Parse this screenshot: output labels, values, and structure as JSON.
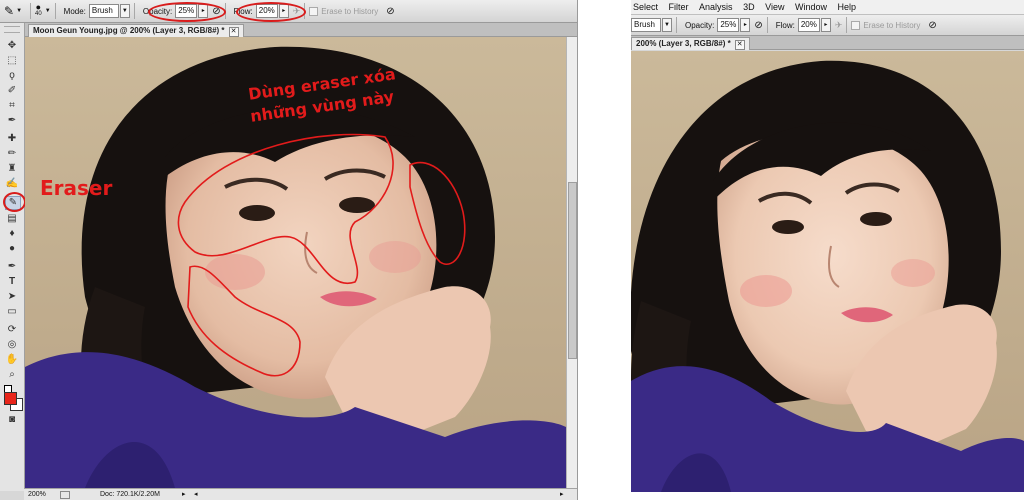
{
  "left": {
    "options": {
      "brush_size": "40",
      "mode_label": "Mode:",
      "mode_value": "Brush",
      "opacity_label": "Opacity:",
      "opacity_value": "25%",
      "flow_label": "Flow:",
      "flow_value": "20%",
      "erase_history": "Erase to History"
    },
    "tab_title": "Moon Geun Young.jpg @ 200% (Layer 3, RGB/8#) *",
    "annotation_title": "Dùng eraser xóa",
    "annotation_title_2": "những vùng này",
    "annotation_tool": "Eraser",
    "status": {
      "zoom": "200%",
      "doc": "Doc: 720.1K/2.20M"
    },
    "colors": {
      "foreground": "#e8251a",
      "annotation": "#e21b1b"
    }
  },
  "right": {
    "menu": [
      "Select",
      "Filter",
      "Analysis",
      "3D",
      "View",
      "Window",
      "Help"
    ],
    "options": {
      "mode_value": "Brush",
      "opacity_label": "Opacity:",
      "opacity_value": "25%",
      "flow_label": "Flow:",
      "flow_value": "20%",
      "erase_history": "Erase to History"
    },
    "tab_title": "200% (Layer 3, RGB/8#) *"
  }
}
